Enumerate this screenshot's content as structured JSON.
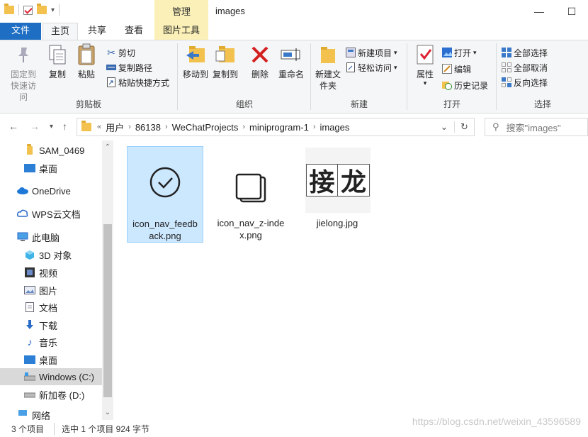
{
  "window": {
    "title": "images",
    "manage_label": "管理"
  },
  "tabs": {
    "file": "文件",
    "home": "主页",
    "share": "共享",
    "view": "查看",
    "picture_tools": "图片工具"
  },
  "ribbon": {
    "clipboard": {
      "label": "剪贴板",
      "pin": "固定到快速访问",
      "copy": "复制",
      "paste": "粘贴",
      "cut": "剪切",
      "copy_path": "复制路径",
      "paste_shortcut": "粘贴快捷方式"
    },
    "organize": {
      "label": "组织",
      "move_to": "移动到",
      "copy_to": "复制到",
      "delete": "删除",
      "rename": "重命名"
    },
    "new": {
      "label": "新建",
      "new_folder": "新建文件夹",
      "new_item": "新建项目",
      "easy_access": "轻松访问"
    },
    "open": {
      "label": "打开",
      "properties": "属性",
      "open": "打开",
      "edit": "编辑",
      "history": "历史记录"
    },
    "select": {
      "label": "选择",
      "select_all": "全部选择",
      "select_none": "全部取消",
      "invert": "反向选择"
    }
  },
  "address": {
    "crumbs": [
      "用户",
      "86138",
      "WeChatProjects",
      "miniprogram-1",
      "images"
    ],
    "search_placeholder": "搜索\"images\""
  },
  "nav": {
    "items": [
      {
        "label": "SAM_0469",
        "icon": "folder-icon"
      },
      {
        "label": "桌面",
        "icon": "desktop-icon"
      },
      {
        "label": "OneDrive",
        "icon": "cloud-icon"
      },
      {
        "label": "WPS云文档",
        "icon": "wps-cloud-icon"
      },
      {
        "label": "此电脑",
        "icon": "computer-icon"
      },
      {
        "label": "3D 对象",
        "icon": "cube-icon"
      },
      {
        "label": "视频",
        "icon": "video-icon"
      },
      {
        "label": "图片",
        "icon": "picture-icon"
      },
      {
        "label": "文档",
        "icon": "document-icon"
      },
      {
        "label": "下载",
        "icon": "download-icon"
      },
      {
        "label": "音乐",
        "icon": "music-icon"
      },
      {
        "label": "桌面",
        "icon": "desktop-icon"
      },
      {
        "label": "Windows (C:)",
        "icon": "drive-icon"
      },
      {
        "label": "新加卷 (D:)",
        "icon": "drive-icon"
      },
      {
        "label": "网络",
        "icon": "network-icon"
      }
    ]
  },
  "files": [
    {
      "name": "icon_nav_feedback.png",
      "selected": true
    },
    {
      "name": "icon_nav_z-index.png",
      "selected": false
    },
    {
      "name": "jielong.jpg",
      "selected": false,
      "image_text": "接龙"
    }
  ],
  "status": {
    "count": "3 个项目",
    "selected": "选中 1 个项目  924 字节"
  },
  "watermark": "https://blog.csdn.net/weixin_43596589"
}
